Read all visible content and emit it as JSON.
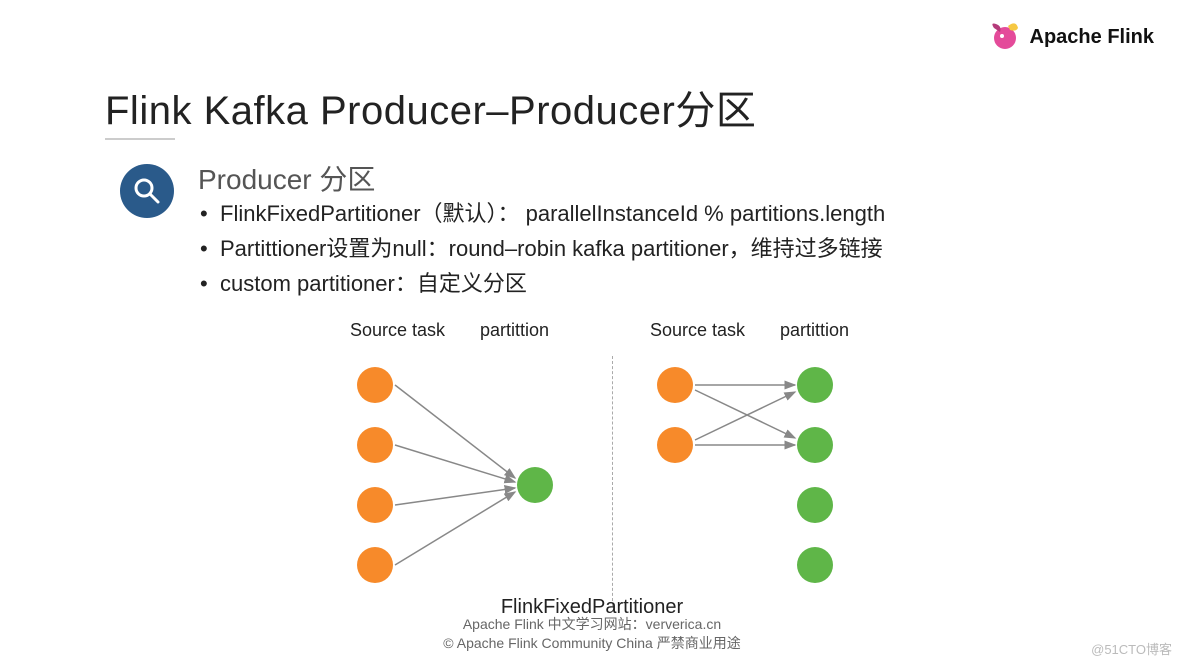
{
  "logo": {
    "text": "Apache Flink"
  },
  "title": "Flink Kafka Producer–Producer分区",
  "section": {
    "heading": "Producer 分区",
    "bullets": [
      "FlinkFixedPartitioner（默认）： parallelInstanceId % partitions.length",
      "Partittioner设置为null：round–robin kafka partitioner，维持过多链接",
      "custom partitioner：自定义分区"
    ]
  },
  "diagram": {
    "left": {
      "source_label": "Source task",
      "partition_label": "partittion"
    },
    "right": {
      "source_label": "Source task",
      "partition_label": "partittion"
    },
    "caption": "FlinkFixedPartitioner"
  },
  "footer": {
    "line1": "Apache Flink 中文学习网站：ververica.cn",
    "line2": "© Apache Flink Community China  严禁商业用途"
  },
  "watermark": "@51CTO博客",
  "chart_data": {
    "type": "diagram",
    "description": "Two side-by-side partitioning illustrations",
    "left_panel": {
      "label": "FlinkFixedPartitioner (default)",
      "source_tasks": 4,
      "partitions": 1,
      "mapping": "all source tasks -> single partition (parallelInstanceId % partitions.length)"
    },
    "right_panel": {
      "label": "round-robin (partitioner=null)",
      "source_tasks": 2,
      "partitions": 4,
      "mapping": "each source task connects to each partition (many-to-many / round-robin)"
    },
    "colors": {
      "source_task": "#f78a2a",
      "partition": "#5fb648",
      "arrow": "#888888"
    }
  }
}
